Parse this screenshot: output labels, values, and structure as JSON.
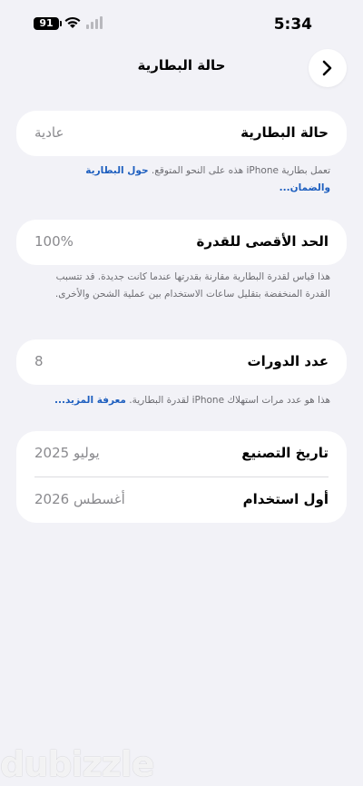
{
  "status_bar": {
    "time": "5:34",
    "battery_level": "91"
  },
  "nav": {
    "title": "حالة البطارية"
  },
  "battery_health": {
    "label": "حالة البطارية",
    "value": "عادية"
  },
  "battery_health_note": {
    "text": "تعمل بطارية iPhone هذه على النحو المتوقع.",
    "link": "حول البطارية والضمان..."
  },
  "max_capacity": {
    "label": "الحد الأقصى للقدرة",
    "value": "100%"
  },
  "max_capacity_note": {
    "text": "هذا قياس لقدرة البطارية مقارنة بقدرتها عندما كانت جديدة. قد تتسبب القدرة المنخفضة بتقليل ساعات الاستخدام بين عملية الشحن والأخرى."
  },
  "cycle_count": {
    "label": "عدد الدورات",
    "value": "8"
  },
  "cycle_count_note": {
    "text": "هذا هو عدد مرات استهلاك iPhone لقدرة البطارية.",
    "link": "معرفة المزيد..."
  },
  "dates": {
    "manufacture": {
      "label": "تاريخ التصنيع",
      "value": "يوليو 2025"
    },
    "first_use": {
      "label": "أول استخدام",
      "value": "أغسطس 2026"
    }
  },
  "watermark": {
    "text": "dubizzle"
  }
}
